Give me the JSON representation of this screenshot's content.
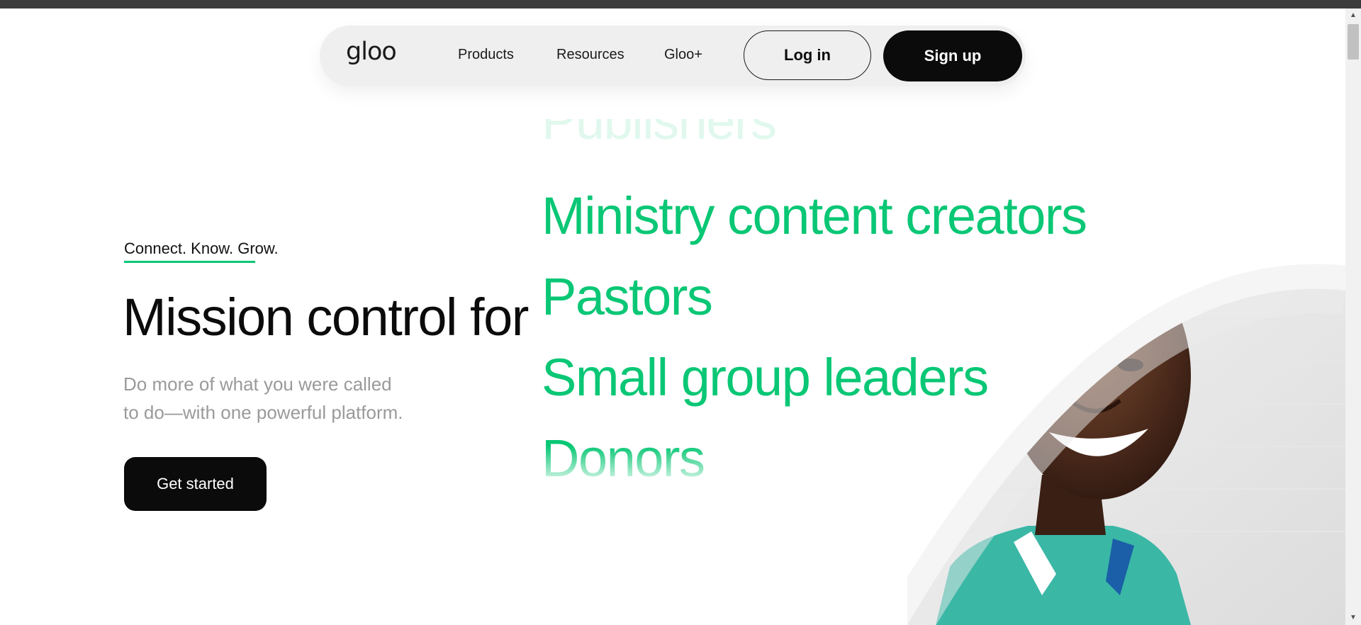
{
  "nav": {
    "logo": "gloo",
    "links": [
      "Products",
      "Resources",
      "Gloo+"
    ],
    "login_label": "Log in",
    "signup_label": "Sign up"
  },
  "hero": {
    "tagline": "Connect. Know. Grow.",
    "headline": "Mission control for",
    "subtext_line1": "Do more of what you were called",
    "subtext_line2": "to do—with one powerful platform.",
    "cta_label": "Get started",
    "rotating_words": [
      "Publishers",
      "Ministry content creators",
      "Pastors",
      "Small group leaders",
      "Donors"
    ]
  },
  "colors": {
    "accent": "#0ac775",
    "dark": "#0b0b0b",
    "nav_bg": "#efefef",
    "muted_text": "#9a9a9a"
  },
  "icons": {
    "scroll_up": "triangle-up-icon",
    "scroll_down": "triangle-down-icon"
  }
}
